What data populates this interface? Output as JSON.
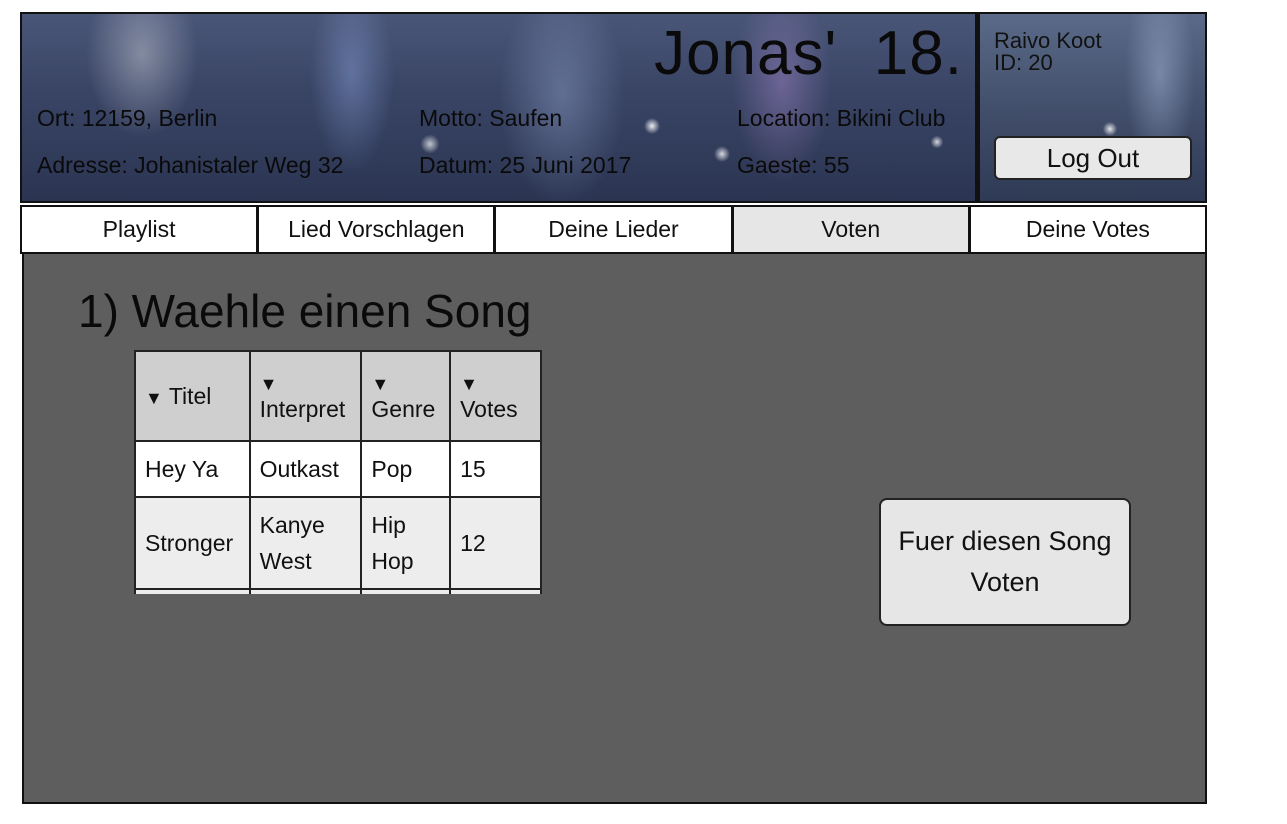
{
  "header": {
    "title": "Jonas'  18.",
    "ort": "Ort: 12159, Berlin",
    "motto": "Motto: Saufen",
    "location": "Location: Bikini Club",
    "adresse": "Adresse: Johanistaler Weg 32",
    "datum": "Datum: 25 Juni 2017",
    "gaeste": "Gaeste: 55"
  },
  "user": {
    "name": "Raivo Koot",
    "id": "ID: 20",
    "logout_label": "Log Out"
  },
  "tabs": [
    {
      "label": "Playlist",
      "active": false
    },
    {
      "label": "Lied Vorschlagen",
      "active": false
    },
    {
      "label": "Deine Lieder",
      "active": false
    },
    {
      "label": "Voten",
      "active": true
    },
    {
      "label": "Deine Votes",
      "active": false
    }
  ],
  "main": {
    "step_title": "1) Waehle einen Song",
    "table": {
      "sort_glyph": "▼",
      "columns": [
        "Titel",
        "Interpret",
        "Genre",
        "Votes"
      ],
      "rows": [
        {
          "titel": "Hey Ya",
          "interpret": "Outkast",
          "genre": "Pop",
          "votes": "15"
        },
        {
          "titel": "Stronger",
          "interpret": "Kanye West",
          "genre": "Hip Hop",
          "votes": "12"
        }
      ]
    },
    "vote_button_label": "Fuer diesen Song Voten"
  }
}
